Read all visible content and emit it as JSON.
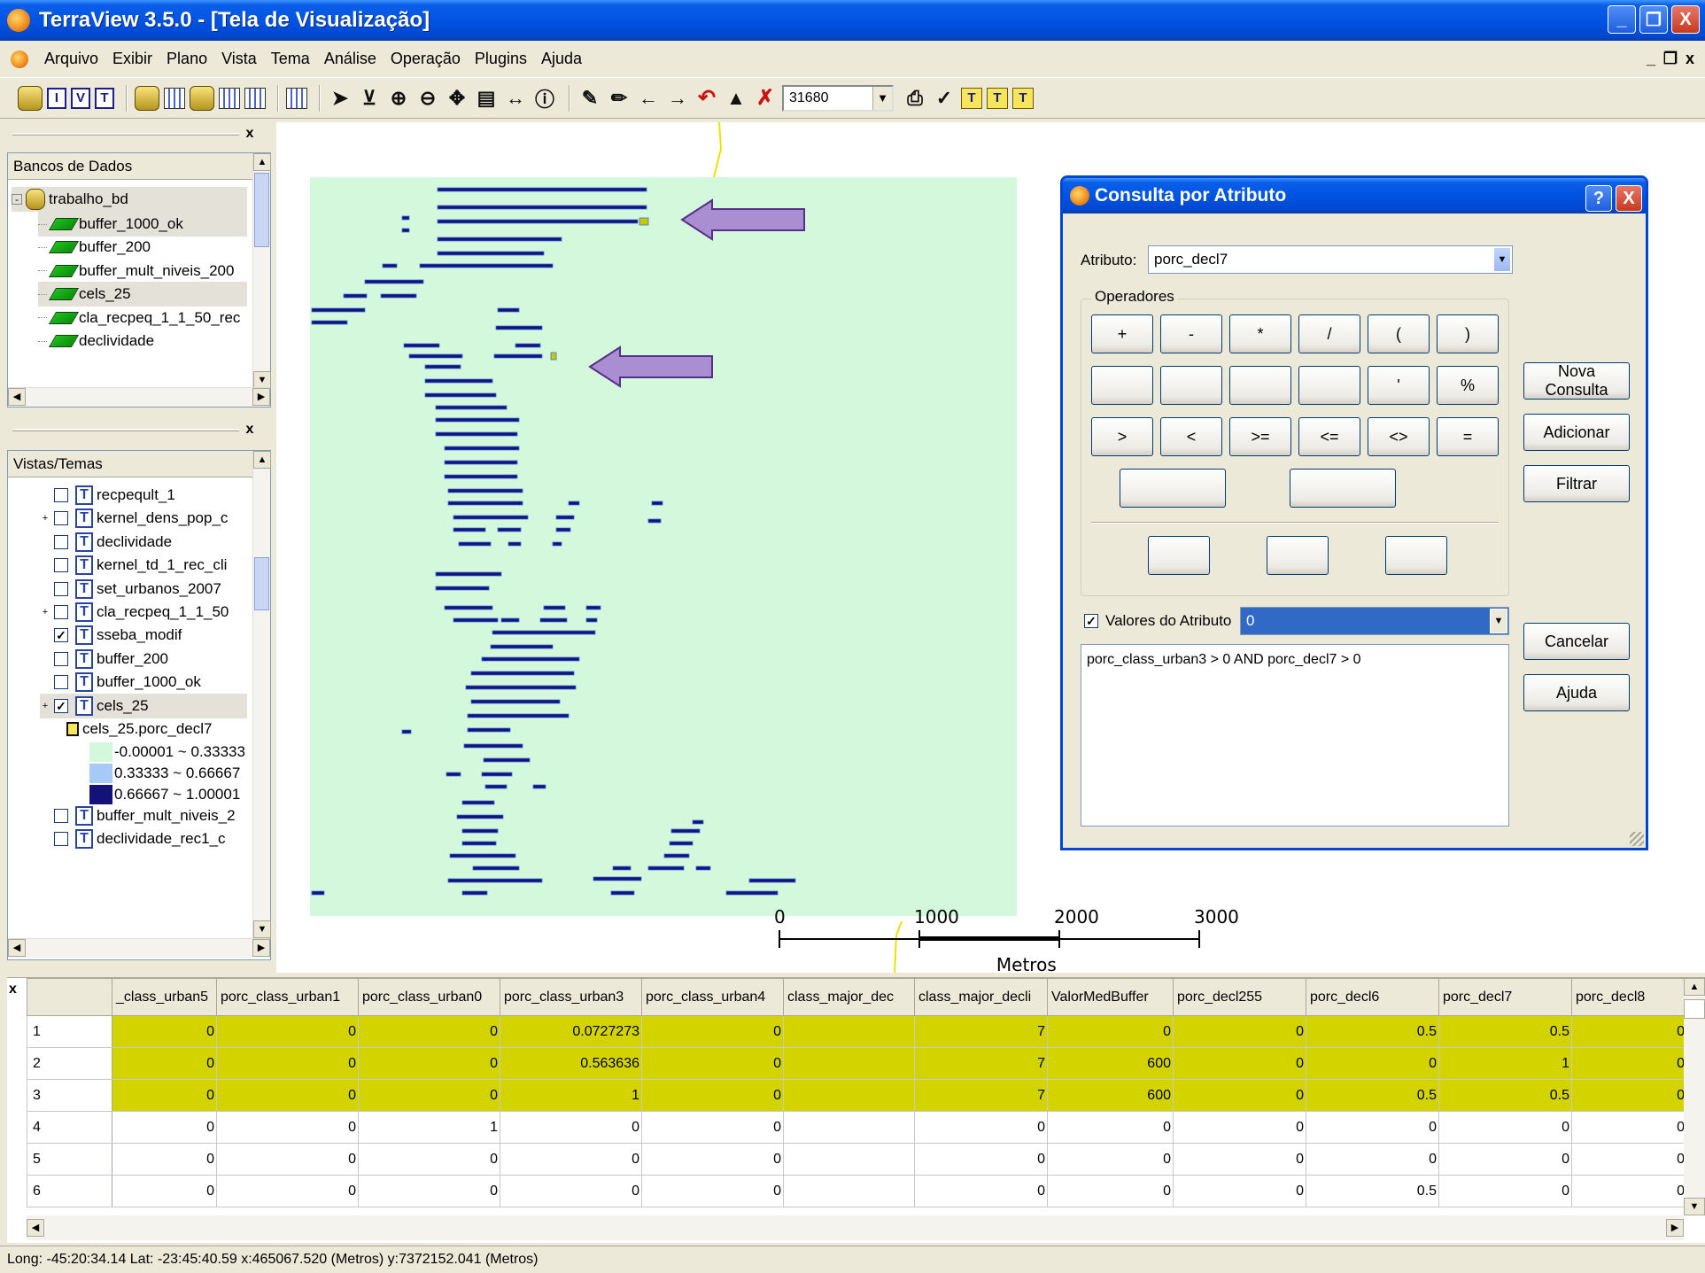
{
  "window": {
    "title": "TerraView 3.5.0 - [Tela de Visualização]",
    "minimize": "_",
    "maximize": "❐",
    "close": "X"
  },
  "menu": {
    "items": [
      "Arquivo",
      "Exibir",
      "Plano",
      "Vista",
      "Tema",
      "Análise",
      "Operação",
      "Plugins",
      "Ajuda"
    ],
    "mdi_min": "_",
    "mdi_restore": "❐",
    "mdi_close": "x"
  },
  "toolbar": {
    "letter_i": "I",
    "letter_v": "V",
    "letter_t": "T",
    "zoom_value": "31680",
    "tl_1": "T",
    "tl_2": "T",
    "tl_3": "T"
  },
  "databases_panel": {
    "header": "Bancos de Dados",
    "root": "trabalho_bd",
    "layers": [
      "buffer_1000_ok",
      "buffer_200",
      "buffer_mult_niveis_200",
      "cels_25",
      "cla_recpeq_1_1_50_rec",
      "declividade"
    ]
  },
  "views_panel": {
    "header": "Vistas/Temas",
    "themes": [
      {
        "label": "recpeqult_1",
        "checked": false
      },
      {
        "label": "kernel_dens_pop_c",
        "checked": false
      },
      {
        "label": "declividade",
        "checked": false
      },
      {
        "label": "kernel_td_1_rec_cli",
        "checked": false
      },
      {
        "label": "set_urbanos_2007",
        "checked": false
      },
      {
        "label": "cla_recpeq_1_1_50",
        "checked": false
      },
      {
        "label": "sseba_modif",
        "checked": true
      },
      {
        "label": "buffer_200",
        "checked": false
      },
      {
        "label": "buffer_1000_ok",
        "checked": false
      },
      {
        "label": "cels_25",
        "checked": true
      }
    ],
    "legend_title": "cels_25.porc_decl7",
    "legend": [
      {
        "label": "-0.00001 ~ 0.33333",
        "color": "#d4f8dc"
      },
      {
        "label": "0.33333 ~ 0.66667",
        "color": "#a7c9f5"
      },
      {
        "label": "0.66667 ~ 1.00001",
        "color": "#12127a"
      }
    ],
    "more_themes": [
      {
        "label": "buffer_mult_niveis_2",
        "checked": false
      },
      {
        "label": "declividade_rec1_c",
        "checked": false
      }
    ],
    "t_letter": "T"
  },
  "map": {
    "scale_labels": [
      "0",
      "1000",
      "2000",
      "3000"
    ],
    "scale_unit": "Metros",
    "background_color": "#d4f8dc",
    "cell_color": "#12127a",
    "edge_color": "#3e6fd9",
    "highlight_color": "#c8c800",
    "arrow_color": "#a98fd1"
  },
  "dialog": {
    "title": "Consulta por Atributo",
    "help": "?",
    "close": "X",
    "attribute_label": "Atributo:",
    "attribute_value": "porc_decl7",
    "operators_label": "Operadores",
    "operators_row1": [
      "+",
      "-",
      "*",
      "/",
      "(",
      ")"
    ],
    "operators_row2": [
      "",
      "",
      "",
      "",
      "'",
      "%"
    ],
    "operators_row3": [
      ">",
      "<",
      ">=",
      "<=",
      "<>",
      "="
    ],
    "blank": "",
    "values_label": "Valores do Atributo",
    "values_value": "0",
    "query_text": "porc_class_urban3 > 0 AND  porc_decl7 > 0",
    "buttons": {
      "nova_consulta": "Nova Consulta",
      "adicionar": "Adicionar",
      "filtrar": "Filtrar",
      "cancelar": "Cancelar",
      "ajuda": "Ajuda"
    }
  },
  "table": {
    "columns": [
      "_class_urban5",
      "porc_class_urban1",
      "porc_class_urban0",
      "porc_class_urban3",
      "porc_class_urban4",
      "class_major_dec",
      "class_major_decli",
      "ValorMedBuffer",
      "porc_decl255",
      "porc_decl6",
      "porc_decl7",
      "porc_decl8"
    ],
    "rows": [
      {
        "n": "1",
        "selected": true,
        "cells": [
          "0",
          "0",
          "0",
          "0.0727273",
          "0",
          "",
          "7",
          "0",
          "0",
          "0.5",
          "0.5",
          "0"
        ]
      },
      {
        "n": "2",
        "selected": true,
        "cells": [
          "0",
          "0",
          "0",
          "0.563636",
          "0",
          "",
          "7",
          "600",
          "0",
          "0",
          "1",
          "0"
        ]
      },
      {
        "n": "3",
        "selected": true,
        "cells": [
          "0",
          "0",
          "0",
          "1",
          "0",
          "",
          "7",
          "600",
          "0",
          "0.5",
          "0.5",
          "0"
        ]
      },
      {
        "n": "4",
        "selected": false,
        "cells": [
          "0",
          "0",
          "1",
          "0",
          "0",
          "",
          "0",
          "0",
          "0",
          "0",
          "0",
          "0"
        ]
      },
      {
        "n": "5",
        "selected": false,
        "cells": [
          "0",
          "0",
          "0",
          "0",
          "0",
          "",
          "0",
          "0",
          "0",
          "0",
          "0",
          "0"
        ]
      },
      {
        "n": "6",
        "selected": false,
        "cells": [
          "0",
          "0",
          "0",
          "0",
          "0",
          "",
          "0",
          "0",
          "0",
          "0.5",
          "0",
          "0"
        ]
      }
    ],
    "close": "x"
  },
  "status": {
    "text": "Long: -45:20:34.14 Lat: -23:45:40.59  x:465067.520 (Metros)  y:7372152.041 (Metros)"
  }
}
